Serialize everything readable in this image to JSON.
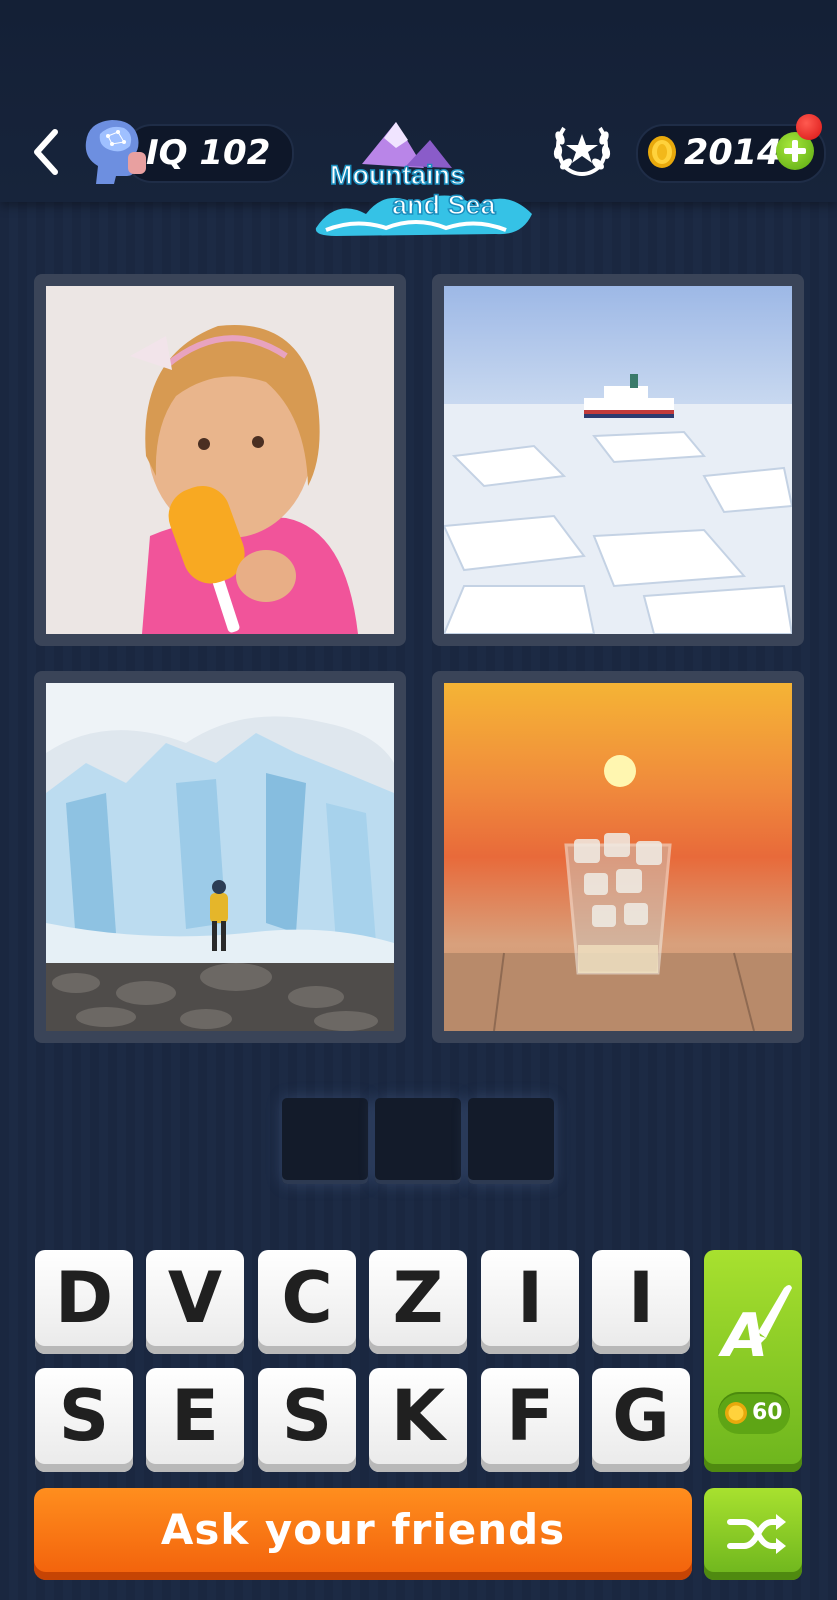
{
  "header": {
    "iq_label": "IQ 102",
    "coins": "2014",
    "level_pack": {
      "line1": "Mountains",
      "line2": "and Sea"
    }
  },
  "photos": [
    {
      "name": "girl-eating-popsicle"
    },
    {
      "name": "ship-in-ice-field"
    },
    {
      "name": "glacier-with-hiker"
    },
    {
      "name": "glass-of-ice-at-sunset"
    }
  ],
  "answer": {
    "slots": [
      "",
      "",
      ""
    ]
  },
  "keyboard": {
    "row1": [
      "D",
      "V",
      "C",
      "Z",
      "I",
      "I"
    ],
    "row2": [
      "S",
      "E",
      "S",
      "K",
      "F",
      "G"
    ]
  },
  "hint": {
    "cost": "60"
  },
  "ask_button": {
    "label": "Ask your friends"
  },
  "colors": {
    "background": "#1a2740",
    "accent_orange": "#f2600b",
    "accent_green": "#8ccb25"
  }
}
